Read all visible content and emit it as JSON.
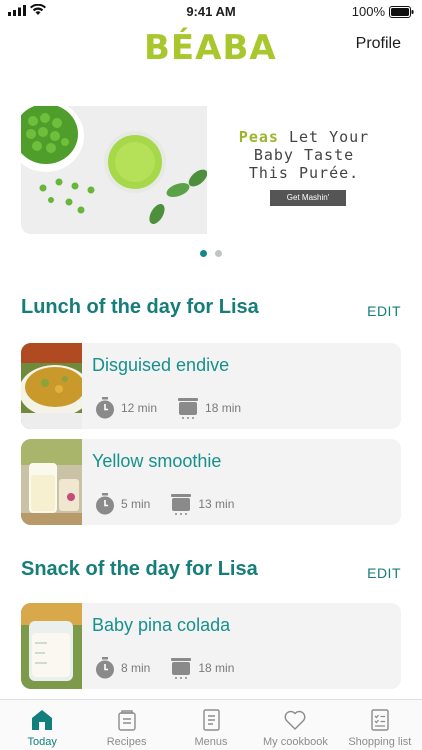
{
  "status": {
    "time": "9:41 AM",
    "battery": "100%"
  },
  "header": {
    "logo": "BÉABA",
    "profile_label": "Profile"
  },
  "banner": {
    "line1_accent": "Peas",
    "line1_rest": " Let Your",
    "line2": "Baby Taste",
    "line3": "This Purée.",
    "cta": "Get Mashin'",
    "page_count": 2,
    "active_index": 0
  },
  "lunch": {
    "title": "Lunch of the day for Lisa",
    "edit_label": "EDIT",
    "recipes": [
      {
        "name": "Disguised endive",
        "prep_time": "12 min",
        "cook_time": "18 min"
      },
      {
        "name": "Yellow smoothie",
        "prep_time": "5 min",
        "cook_time": "13 min"
      }
    ]
  },
  "snack": {
    "title": "Snack of the day for Lisa",
    "edit_label": "EDIT",
    "recipes": [
      {
        "name": "Baby pina colada",
        "prep_time": "8 min",
        "cook_time": "18 min"
      }
    ]
  },
  "tabbar": {
    "tabs": [
      {
        "label": "Today",
        "icon": "home-icon",
        "active": true
      },
      {
        "label": "Recipes",
        "icon": "recipe-jar-icon",
        "active": false
      },
      {
        "label": "Menus",
        "icon": "menu-book-icon",
        "active": false
      },
      {
        "label": "My cookbook",
        "icon": "heart-icon",
        "active": false
      },
      {
        "label": "Shopping list",
        "icon": "checklist-icon",
        "active": false
      }
    ]
  },
  "colors": {
    "brand": "#a8c72c",
    "accent": "#157d7a",
    "card_bg": "#f3f3f3"
  }
}
